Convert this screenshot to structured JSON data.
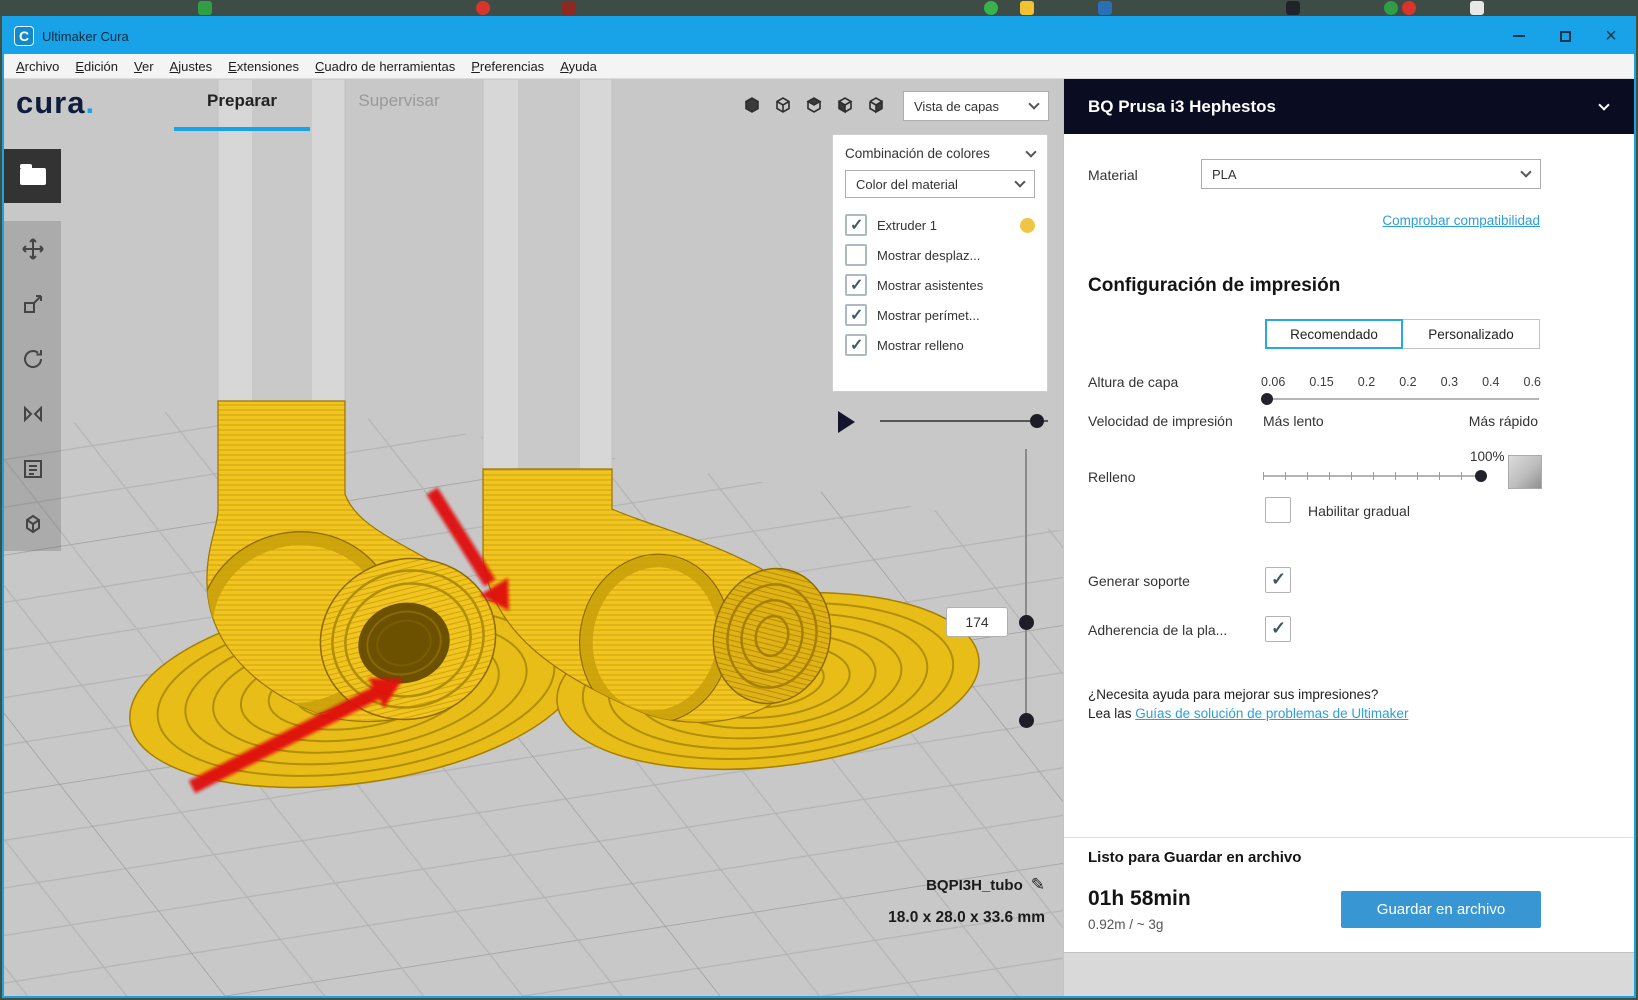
{
  "window": {
    "title": "Ultimaker Cura"
  },
  "menu": {
    "items": [
      {
        "label": "Archivo"
      },
      {
        "label": "Edición"
      },
      {
        "label": "Ver"
      },
      {
        "label": "Ajustes"
      },
      {
        "label": "Extensiones"
      },
      {
        "label": "Cuadro de herramientas"
      },
      {
        "label": "Preferencias"
      },
      {
        "label": "Ayuda"
      }
    ]
  },
  "brand": {
    "name": "cura",
    "dot": "."
  },
  "stage_tabs": {
    "prepare": "Preparar",
    "monitor": "Supervisar"
  },
  "view_mode_dropdown": {
    "value": "Vista de capas"
  },
  "color_panel": {
    "title": "Combinación de colores",
    "dropdown_value": "Color del material",
    "checkboxes": [
      {
        "label": "Extruder 1",
        "checked": true,
        "swatch_color": "#efc643"
      },
      {
        "label": "Mostrar desplaz...",
        "checked": false
      },
      {
        "label": "Mostrar asistentes",
        "checked": true
      },
      {
        "label": "Mostrar perímet...",
        "checked": true
      },
      {
        "label": "Mostrar relleno",
        "checked": true
      }
    ]
  },
  "layer_slider": {
    "value": "174"
  },
  "model_info": {
    "name": "BQPI3H_tubo",
    "dimensions": "18.0 x 28.0 x 33.6 mm"
  },
  "machine": {
    "name": "BQ Prusa i3 Hephestos"
  },
  "material": {
    "label": "Material",
    "value": "PLA",
    "compatibility_link": "Comprobar compatibilidad"
  },
  "print_setup": {
    "title": "Configuración de impresión",
    "tabs": {
      "recommended": "Recomendado",
      "custom": "Personalizado"
    },
    "layer_height": {
      "label": "Altura de capa",
      "ticks": [
        "0.06",
        "0.15",
        "0.2",
        "0.2",
        "0.3",
        "0.4",
        "0.6"
      ]
    },
    "print_speed": {
      "label": "Velocidad de impresión",
      "min": "Más lento",
      "max": "Más rápido"
    },
    "infill": {
      "label": "Relleno",
      "value": "100%",
      "gradual_label": "Habilitar gradual"
    },
    "support": {
      "label": "Generar soporte",
      "checked": true
    },
    "adhesion": {
      "label": "Adherencia de la pla...",
      "checked": true
    },
    "help": {
      "question": "¿Necesita ayuda para mejorar sus impresiones?",
      "prefix": "Lea las ",
      "link": "Guías de solución de problemas de Ultimaker"
    }
  },
  "save_panel": {
    "status": "Listo para Guardar en archivo",
    "time": "01h 58min",
    "material_usage": "0.92m / ~ 3g",
    "button": "Guardar en archivo"
  },
  "accent_colors": {
    "titlebar": "#18a2e8",
    "model_yellow": "#f1c51e",
    "arrow_red": "#e01010"
  }
}
